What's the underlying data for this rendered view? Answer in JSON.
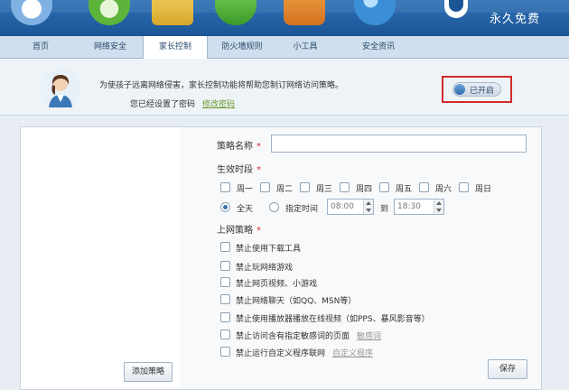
{
  "brand": {
    "slogan": "永久免费"
  },
  "nav": {
    "tabs": [
      {
        "label": "首页"
      },
      {
        "label": "网络安全"
      },
      {
        "label": "家长控制"
      },
      {
        "label": "防火墙规则"
      },
      {
        "label": "小工具"
      },
      {
        "label": "安全资讯"
      }
    ]
  },
  "notice": {
    "text": "为使孩子远离网络侵害，家长控制功能将帮助您制订网络访问策略。",
    "password_set": "您已经设置了密码",
    "change_password": "修改密码"
  },
  "toggle": {
    "label": "已开启",
    "on": true
  },
  "form": {
    "name_label": "策略名称",
    "name_value": "",
    "required_mark": "*",
    "period_label": "生效时段",
    "days": [
      "周一",
      "周二",
      "周三",
      "周四",
      "周五",
      "周六",
      "周日"
    ],
    "all_day": "全天",
    "specified_time": "指定时间",
    "start_time": "08:00",
    "to": "到",
    "end_time": "18:30",
    "policy_label": "上网策略",
    "policies": [
      {
        "label": "禁止使用下载工具"
      },
      {
        "label": "禁止玩网络游戏"
      },
      {
        "label": "禁止网页视频、小游戏"
      },
      {
        "label": "禁止网络聊天（如QQ、MSN等）"
      },
      {
        "label": "禁止使用播放器播放在线视频（如PPS、暴风影音等）"
      },
      {
        "label": "禁止访问含有指定敏感词的页面",
        "link": "敏感词"
      },
      {
        "label": "禁止运行自定义程序联网",
        "link": "自定义程序"
      }
    ]
  },
  "buttons": {
    "add_policy": "添加策略",
    "save": "保存"
  },
  "colors": {
    "header": "#1b5596",
    "highlight_box": "#d32b2b",
    "link_green": "#6a9a2a"
  }
}
